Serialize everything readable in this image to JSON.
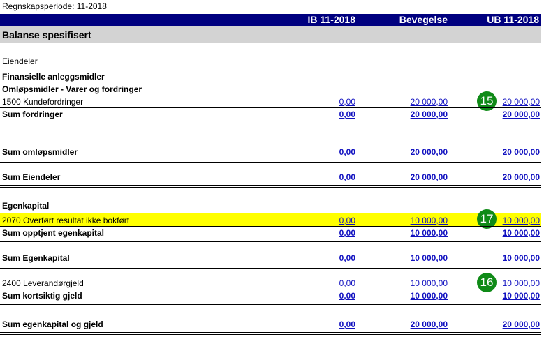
{
  "header_cut": "Regnskapsperiode: 11-2018",
  "period": "Regnskapsperiode: 11-2018",
  "columns": {
    "ib": "IB 11-2018",
    "bev": "Bevegelse",
    "ub": "UB 11-2018"
  },
  "title": "Balanse spesifisert",
  "sections": {
    "eiendeler": "Eiendeler",
    "finansielle": "Finansielle anleggsmidler",
    "omlop": "Omløpsmidler - Varer og  fordringer",
    "egenkapital": "Egenkapital"
  },
  "rows": {
    "r1500": {
      "label": "1500 Kundefordringer",
      "ib": "0,00",
      "bev": "20 000,00",
      "ub": "20 000,00"
    },
    "sum_fordringer": {
      "label": "Sum fordringer",
      "ib": "0,00",
      "bev": "20 000,00",
      "ub": "20 000,00"
    },
    "sum_omlop": {
      "label": "Sum omløpsmidler",
      "ib": "0,00",
      "bev": "20 000,00",
      "ub": "20 000,00"
    },
    "sum_eiendeler": {
      "label": "Sum Eiendeler",
      "ib": "0,00",
      "bev": "20 000,00",
      "ub": "20 000,00"
    },
    "r2070": {
      "label": "2070 Overført resultat ikke bokført",
      "ib": "0,00",
      "bev": "10 000,00",
      "ub": "10 000,00"
    },
    "sum_opptjent": {
      "label": "Sum opptjent egenkapital",
      "ib": "0,00",
      "bev": "10 000,00",
      "ub": "10 000,00"
    },
    "sum_egenkapital": {
      "label": "Sum Egenkapital",
      "ib": "0,00",
      "bev": "10 000,00",
      "ub": "10 000,00"
    },
    "r2400": {
      "label": "2400 Leverandørgjeld",
      "ib": "0,00",
      "bev": "10 000,00",
      "ub": "10 000,00"
    },
    "sum_kortsiktig": {
      "label": "Sum kortsiktig gjeld",
      "ib": "0,00",
      "bev": "10 000,00",
      "ub": "10 000,00"
    },
    "sum_ek_gjeld": {
      "label": "Sum egenkapital og gjeld",
      "ib": "0,00",
      "bev": "20 000,00",
      "ub": "20 000,00"
    }
  },
  "badges": {
    "b15": "15",
    "b17": "17",
    "b16": "16"
  },
  "colors": {
    "header": "#00007f",
    "title_bg": "#d3d3d3",
    "highlight": "#ffff00",
    "badge": "#0f8a17",
    "link": "#1010c0"
  }
}
